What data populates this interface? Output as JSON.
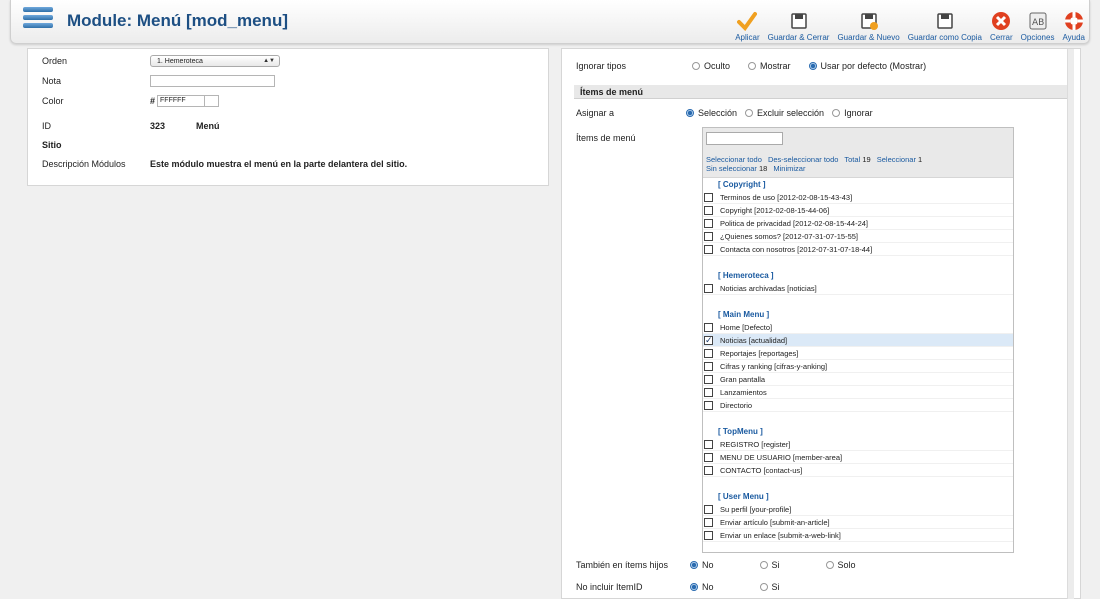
{
  "header": {
    "title": "Module: Menú [mod_menu]"
  },
  "toolbar": [
    {
      "label": "Aplicar",
      "icon": "check-icon"
    },
    {
      "label": "Guardar & Cerrar",
      "icon": "save-icon"
    },
    {
      "label": "Guardar & Nuevo",
      "icon": "save-new-icon"
    },
    {
      "label": "Guardar como Copia",
      "icon": "save-copy-icon"
    },
    {
      "label": "Cerrar",
      "icon": "close-icon"
    },
    {
      "label": "Opciones",
      "icon": "options-icon"
    },
    {
      "label": "Ayuda",
      "icon": "help-icon"
    }
  ],
  "left": {
    "orden_label": "Orden",
    "orden_value": "1. Hemeroteca",
    "nota_label": "Nota",
    "color_label": "Color",
    "color_hash": "#",
    "color_value": "FFFFFF",
    "id_label": "ID",
    "id_value": "323",
    "id_type": "Menú",
    "sitio_label": "Sitio",
    "desc_label": "Descripción Módulos",
    "desc_value": "Este módulo muestra el menú en la parte delantera del sitio."
  },
  "right": {
    "ignorar_label": "Ignorar tipos",
    "ignorar_options": [
      "Oculto",
      "Mostrar",
      "Usar por defecto (Mostrar)"
    ],
    "section_title": "Ítems de menú",
    "asignar_label": "Asignar a",
    "asignar_options": [
      "Selección",
      "Excluir selección",
      "Ignorar"
    ],
    "items_label": "Ítems de menú",
    "links": {
      "select_all": "Seleccionar todo",
      "deselect_all": "Des-seleccionar todo",
      "total_label": "Total",
      "total_value": "19",
      "select_label": "Seleccionar",
      "select_value": "1",
      "unselected_label": "Sin seleccionar",
      "unselected_value": "18",
      "minimize": "Minimizar"
    },
    "groups": [
      {
        "title": "[ Copyright ]",
        "items": [
          {
            "label": "Terminos de uso [2012-02-08-15-43-43]",
            "checked": false
          },
          {
            "label": "Copyright [2012-02-08-15-44-06]",
            "checked": false
          },
          {
            "label": "Politica de privacidad [2012-02-08-15-44-24]",
            "checked": false
          },
          {
            "label": "¿Quienes somos? [2012-07-31-07-15-55]",
            "checked": false
          },
          {
            "label": "Contacta con nosotros [2012-07-31-07-18-44]",
            "checked": false
          }
        ]
      },
      {
        "title": "[ Hemeroteca ]",
        "items": [
          {
            "label": "Noticias archivadas [noticias]",
            "checked": false
          }
        ]
      },
      {
        "title": "[ Main Menu ]",
        "items": [
          {
            "label": "Home [Defecto]",
            "checked": false
          },
          {
            "label": "Noticias [actualidad]",
            "checked": true
          },
          {
            "label": "Reportajes [reportages]",
            "checked": false
          },
          {
            "label": "Cifras y ranking [cifras-y-anking]",
            "checked": false
          },
          {
            "label": "Gran pantalla",
            "checked": false
          },
          {
            "label": "Lanzamientos",
            "checked": false
          },
          {
            "label": "Directorio",
            "checked": false
          }
        ]
      },
      {
        "title": "[ TopMenu ]",
        "items": [
          {
            "label": "REGISTRO [register]",
            "checked": false
          },
          {
            "label": "MENU DE USUARIO [member-area]",
            "checked": false
          },
          {
            "label": "CONTACTO [contact-us]",
            "checked": false
          }
        ]
      },
      {
        "title": "[ User Menu ]",
        "items": [
          {
            "label": "Su perfil [your-profile]",
            "checked": false
          },
          {
            "label": "Enviar artículo [submit-an-article]",
            "checked": false
          },
          {
            "label": "Enviar un enlace [submit-a-web-link]",
            "checked": false
          }
        ]
      }
    ],
    "hijos_label": "También en ítems hijos",
    "hijos_options": [
      "No",
      "Si",
      "Solo"
    ],
    "itemid_label": "No incluir ItemID",
    "itemid_options": [
      "No",
      "Si"
    ]
  },
  "colors": {
    "accent": "#1a5aa0",
    "title": "#1d4f83",
    "apply": "#f0a020",
    "close": "#e04020"
  }
}
